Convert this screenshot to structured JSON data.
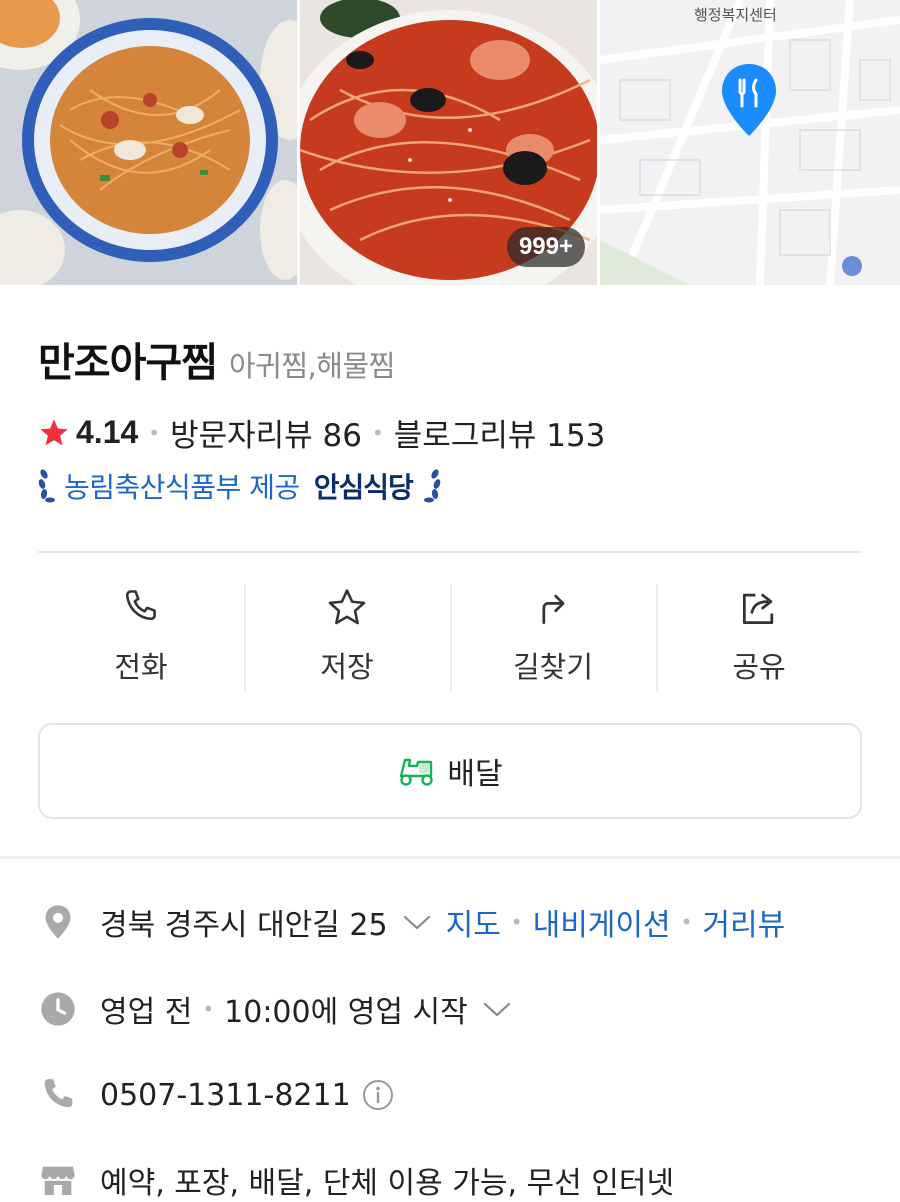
{
  "photos": {
    "count_badge": "999+",
    "map_label": "행정복지센터"
  },
  "place": {
    "name": "만조아구찜",
    "category": "아귀찜,해물찜"
  },
  "rating": {
    "score": "4.14",
    "visitor_reviews": "방문자리뷰 86",
    "blog_reviews": "블로그리뷰 153"
  },
  "badge": {
    "text": "농림축산식품부 제공",
    "strong": "안심식당"
  },
  "actions": [
    {
      "label": "전화",
      "icon": "phone-icon"
    },
    {
      "label": "저장",
      "icon": "star-outline-icon"
    },
    {
      "label": "길찾기",
      "icon": "directions-icon"
    },
    {
      "label": "공유",
      "icon": "share-icon"
    }
  ],
  "delivery": {
    "label": "배달"
  },
  "info": {
    "address": "경북 경주시 대안길 25",
    "map_link": "지도",
    "navi_link": "내비게이션",
    "street_link": "거리뷰",
    "hours_status": "영업 전",
    "hours_detail": "10:00에 영업 시작",
    "phone": "0507-1311-8211",
    "services": "예약, 포장, 배달, 단체 이용 가능, 무선 인터넷"
  },
  "colors": {
    "accent_blue": "#1b66c9",
    "star_red": "#f0303a",
    "delivery_green": "#19b05b",
    "map_pin_blue": "#1a8cff"
  }
}
